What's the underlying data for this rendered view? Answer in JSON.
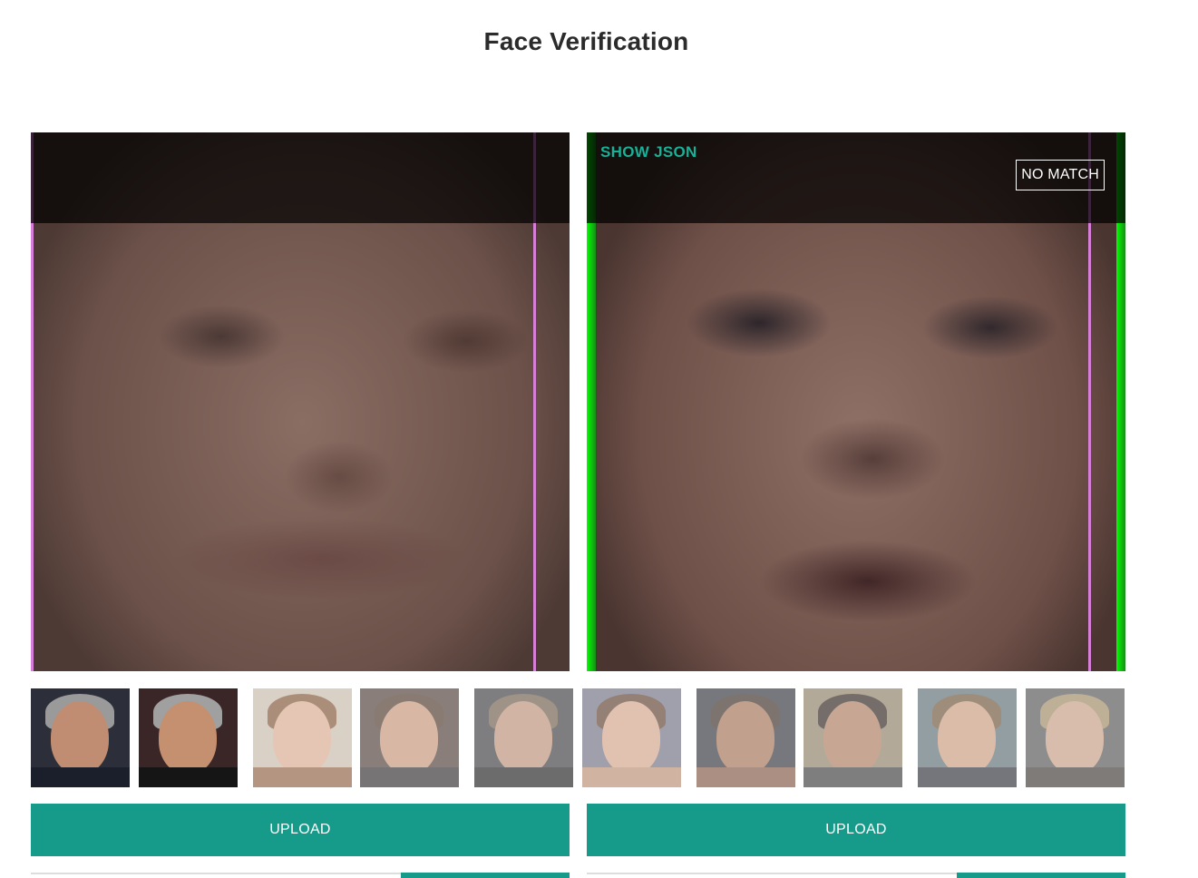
{
  "title": "Face Verification",
  "right_panel": {
    "show_json_label": "SHOW JSON",
    "result_badge": "NO MATCH"
  },
  "thumbnails": [
    {
      "name": "thumbnail-1",
      "dim": false
    },
    {
      "name": "thumbnail-2",
      "dim": false
    },
    {
      "name": "thumbnail-3",
      "dim": true
    },
    {
      "name": "thumbnail-4",
      "dim": true
    },
    {
      "name": "thumbnail-5",
      "dim": true
    },
    {
      "name": "thumbnail-6",
      "dim": true
    },
    {
      "name": "thumbnail-7",
      "dim": true
    },
    {
      "name": "thumbnail-8",
      "dim": true
    },
    {
      "name": "thumbnail-9",
      "dim": true
    },
    {
      "name": "thumbnail-10",
      "dim": true
    }
  ],
  "upload_left": {
    "label": "UPLOAD"
  },
  "upload_right": {
    "label": "UPLOAD"
  },
  "colors": {
    "accent": "#169b8a",
    "show_json_text": "#16b196",
    "match_border": "#00ff00",
    "face_box_edge": "#d77fd8"
  }
}
